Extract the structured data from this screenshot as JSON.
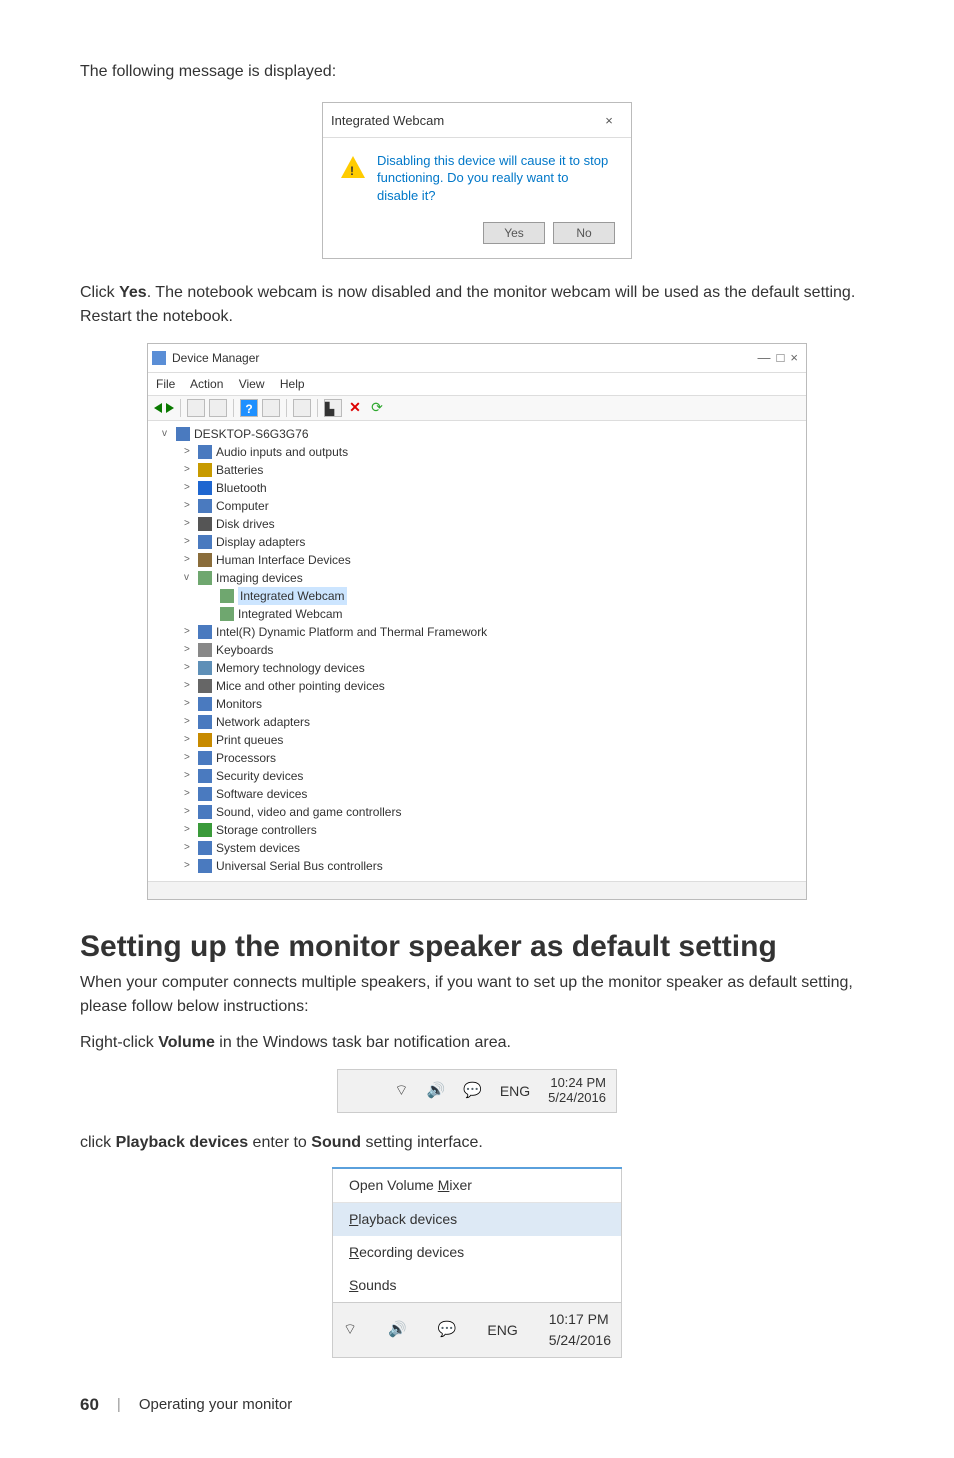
{
  "intro_text_1": "The following message is displayed:",
  "dialog": {
    "title": "Integrated Webcam",
    "close_label": "×",
    "message": "Disabling this device will cause it to stop functioning. Do you really want to disable it?",
    "yes_label": "Yes",
    "no_label": "No"
  },
  "intro_text_2a": "Click ",
  "intro_text_2_bold": "Yes",
  "intro_text_2b": ". The notebook webcam is now disabled and the monitor webcam will be used as the default setting. Restart the notebook.",
  "device_manager": {
    "title": "Device Manager",
    "sys_minimize": "—",
    "sys_maximize": "□",
    "sys_close": "×",
    "menu": {
      "file": "File",
      "action": "Action",
      "view": "View",
      "help": "Help"
    },
    "root": "DESKTOP-S6G3G76",
    "items": [
      {
        "label": "Audio inputs and outputs",
        "chevron": ">",
        "color": "#4a7abf"
      },
      {
        "label": "Batteries",
        "chevron": ">",
        "color": "#c79a00"
      },
      {
        "label": "Bluetooth",
        "chevron": ">",
        "color": "#1e66d0"
      },
      {
        "label": "Computer",
        "chevron": ">",
        "color": "#4a7abf"
      },
      {
        "label": "Disk drives",
        "chevron": ">",
        "color": "#555555"
      },
      {
        "label": "Display adapters",
        "chevron": ">",
        "color": "#4a7abf"
      },
      {
        "label": "Human Interface Devices",
        "chevron": ">",
        "color": "#8a6d3b"
      },
      {
        "label": "Imaging devices",
        "chevron": "v",
        "color": "#6fa76f",
        "children": [
          {
            "label": "Integrated Webcam",
            "highlight": true
          },
          {
            "label": "Integrated Webcam",
            "highlight": false
          }
        ]
      },
      {
        "label": "Intel(R) Dynamic Platform and Thermal Framework",
        "chevron": ">",
        "color": "#4a7abf"
      },
      {
        "label": "Keyboards",
        "chevron": ">",
        "color": "#888888"
      },
      {
        "label": "Memory technology devices",
        "chevron": ">",
        "color": "#5e8fb7"
      },
      {
        "label": "Mice and other pointing devices",
        "chevron": ">",
        "color": "#666666"
      },
      {
        "label": "Monitors",
        "chevron": ">",
        "color": "#4a7abf"
      },
      {
        "label": "Network adapters",
        "chevron": ">",
        "color": "#4a7abf"
      },
      {
        "label": "Print queues",
        "chevron": ">",
        "color": "#c78a00"
      },
      {
        "label": "Processors",
        "chevron": ">",
        "color": "#4a7abf"
      },
      {
        "label": "Security devices",
        "chevron": ">",
        "color": "#4a7abf"
      },
      {
        "label": "Software devices",
        "chevron": ">",
        "color": "#4a7abf"
      },
      {
        "label": "Sound, video and game controllers",
        "chevron": ">",
        "color": "#4a7abf"
      },
      {
        "label": "Storage controllers",
        "chevron": ">",
        "color": "#3a9a3a"
      },
      {
        "label": "System devices",
        "chevron": ">",
        "color": "#4a7abf"
      },
      {
        "label": "Universal Serial Bus controllers",
        "chevron": ">",
        "color": "#4a7abf"
      }
    ]
  },
  "heading": "Setting up the monitor speaker as default setting",
  "p1": "When your computer connects multiple speakers, if you want to set up the monitor speaker as default setting, please follow below instructions:",
  "p2a": "Right-click ",
  "p2_bold": "Volume",
  "p2b": " in the Windows task bar notification area.",
  "taskbar1": {
    "lang": "ENG",
    "time": "10:24 PM",
    "date": "5/24/2016"
  },
  "p3a": "click ",
  "p3_bold1": "Playback devices",
  "p3_mid": " enter to ",
  "p3_bold2": "Sound",
  "p3b": " setting interface.",
  "context_menu": {
    "open_mixer_pre": "Open Volume ",
    "open_mixer_acc": "M",
    "open_mixer_post": "ixer",
    "playback_acc": "P",
    "playback_post": "layback devices",
    "recording_acc": "R",
    "recording_post": "ecording devices",
    "sounds_acc": "S",
    "sounds_post": "ounds"
  },
  "taskbar2": {
    "lang": "ENG",
    "time": "10:17 PM",
    "date": "5/24/2016"
  },
  "footer": {
    "page": "60",
    "separator": "|",
    "section": "Operating your monitor"
  }
}
